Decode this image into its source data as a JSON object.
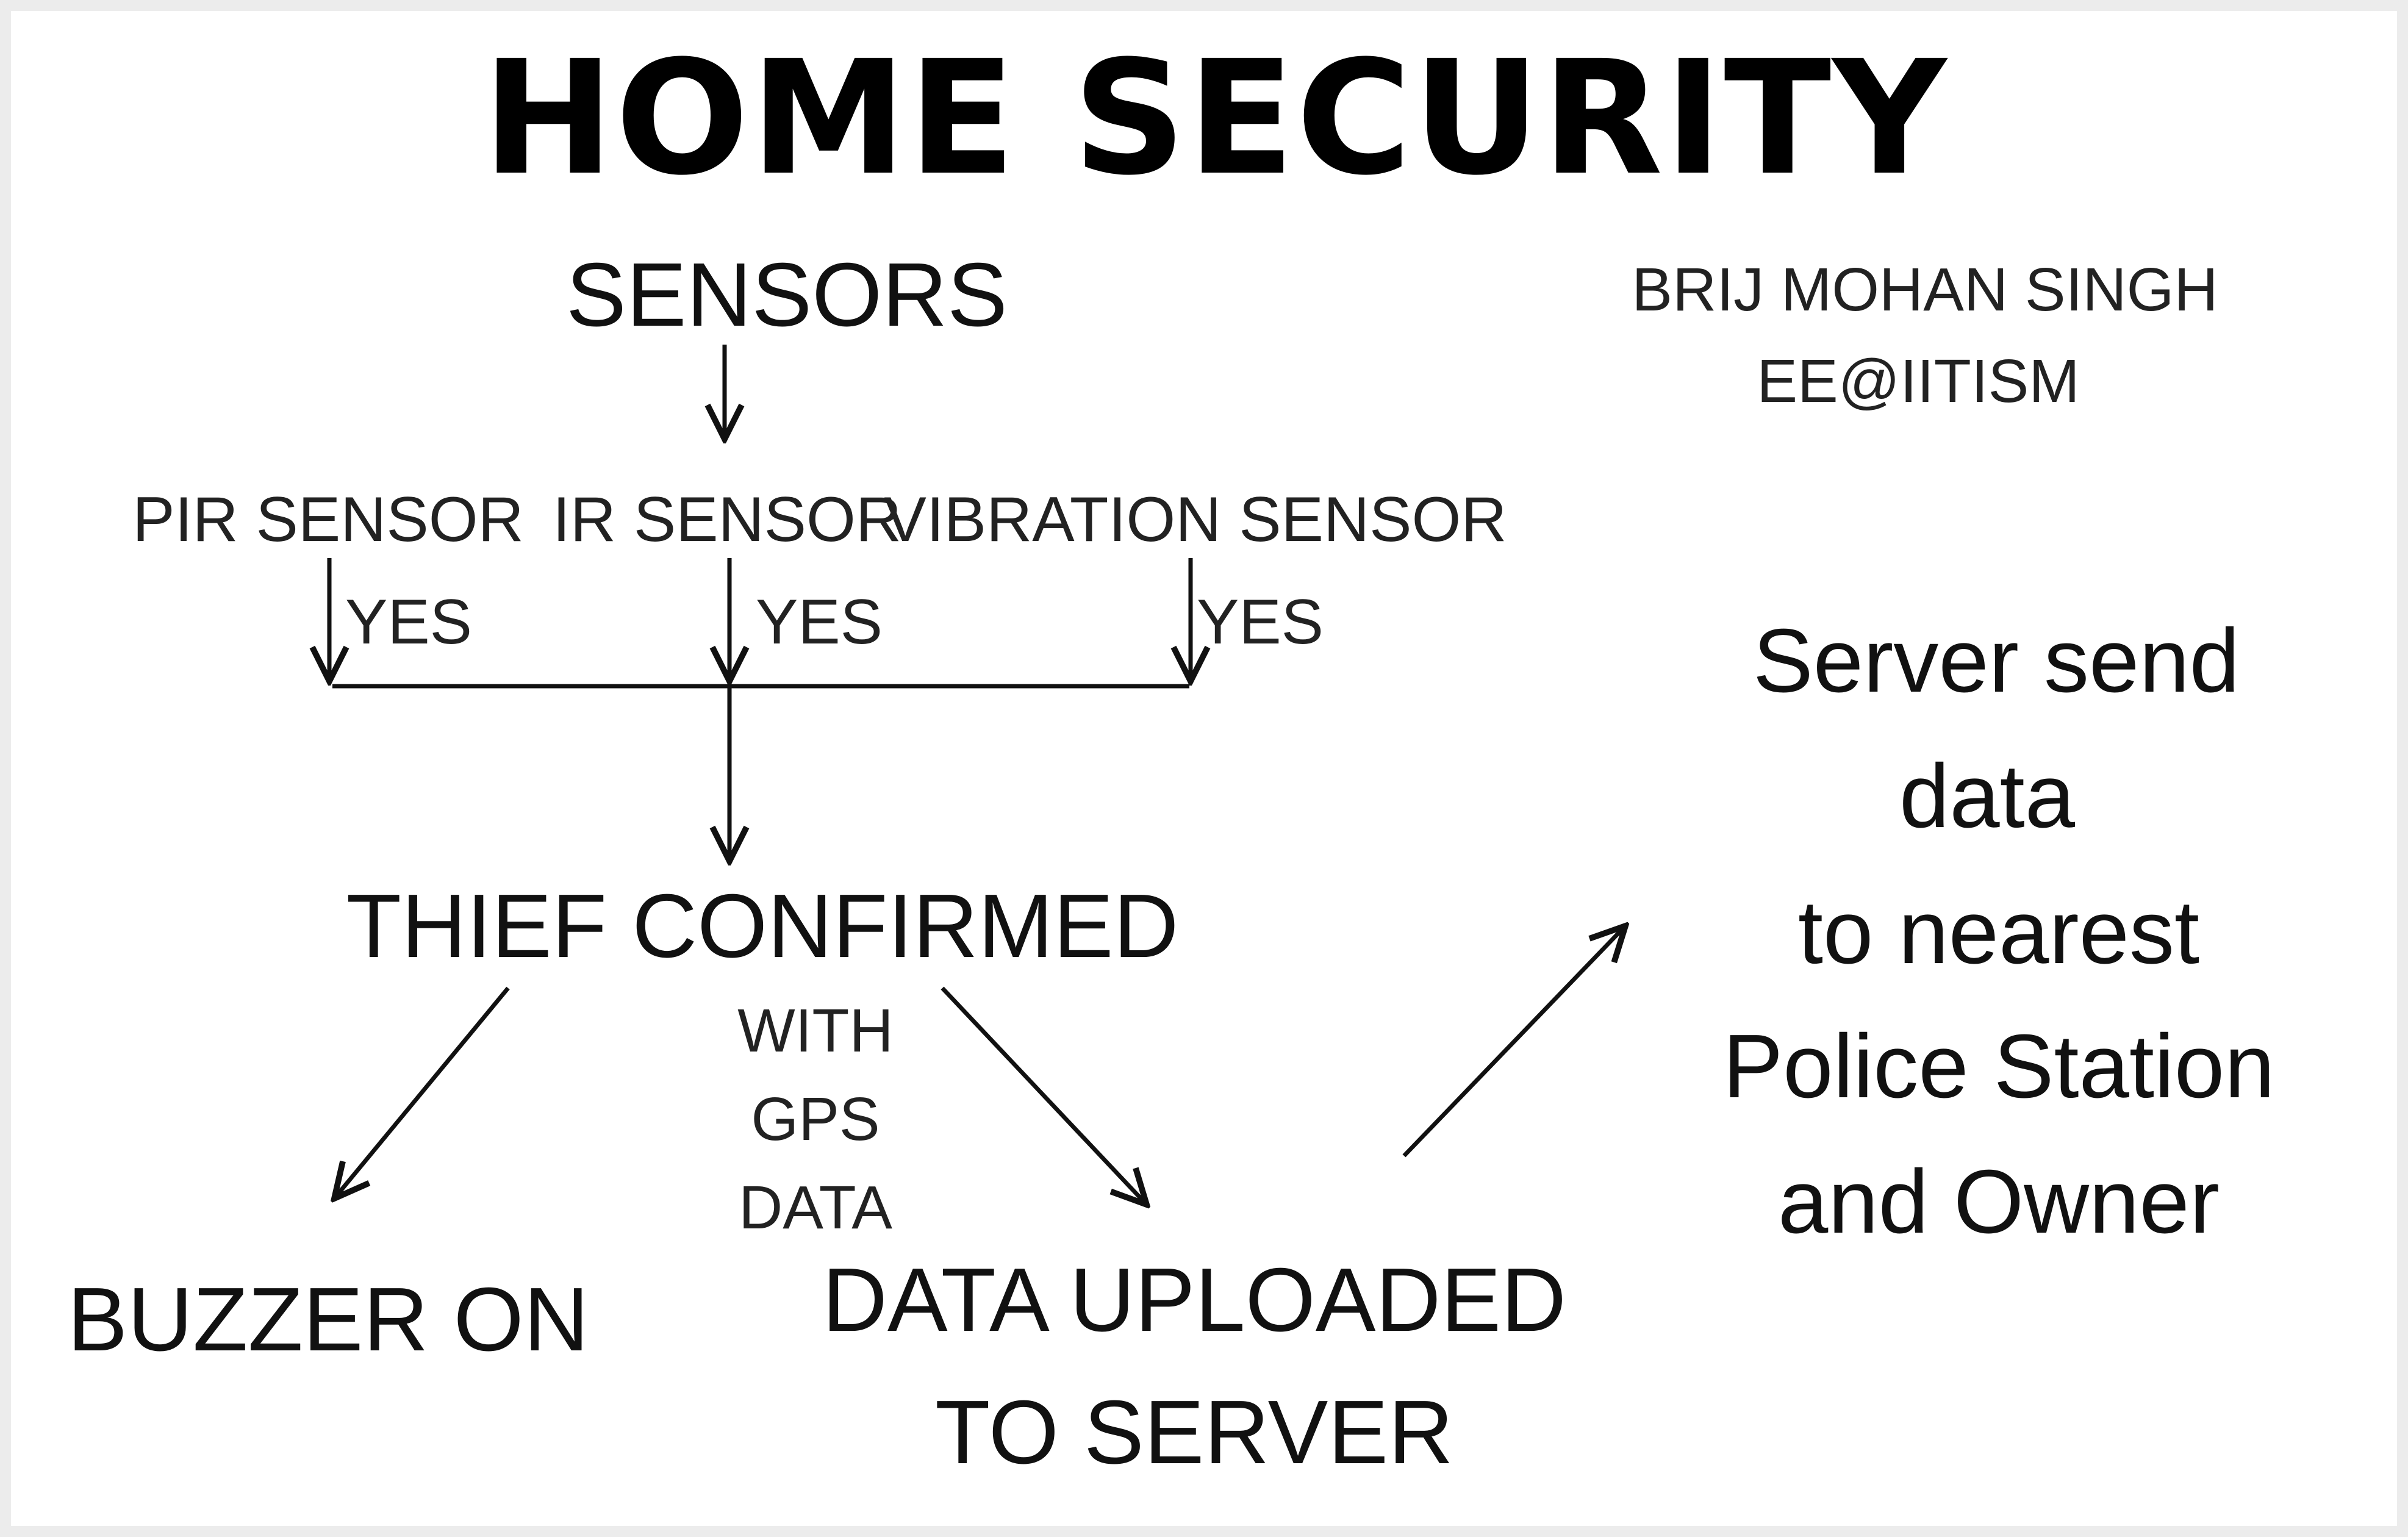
{
  "title": "HOME SECURITY",
  "author": {
    "name": "BRIJ MOHAN SINGH",
    "affiliation": "EE@IITISM"
  },
  "nodes": {
    "sensors": "SENSORS",
    "pir_sensor": "PIR SENSOR",
    "ir_sensor": "IR SENSOR",
    "vibration_sensor": "VIBRATION SENSOR",
    "thief_confirmed": "THIEF CONFIRMED",
    "buzzer_on": "BUZZER ON",
    "data_uploaded_line1": "DATA UPLOADED",
    "data_uploaded_line2": "TO SERVER",
    "server_send_lines": [
      "Server send",
      "data",
      "to nearest",
      "Police Station",
      "and Owner"
    ]
  },
  "edge_labels": {
    "pir_yes": "YES",
    "ir_yes": "YES",
    "vibration_yes": "YES",
    "gps_lines": [
      "WITH",
      "GPS",
      "DATA"
    ]
  },
  "colors": {
    "background": "#ffffff",
    "border": "#ececec",
    "text": "#111111",
    "arrow": "#111111"
  }
}
